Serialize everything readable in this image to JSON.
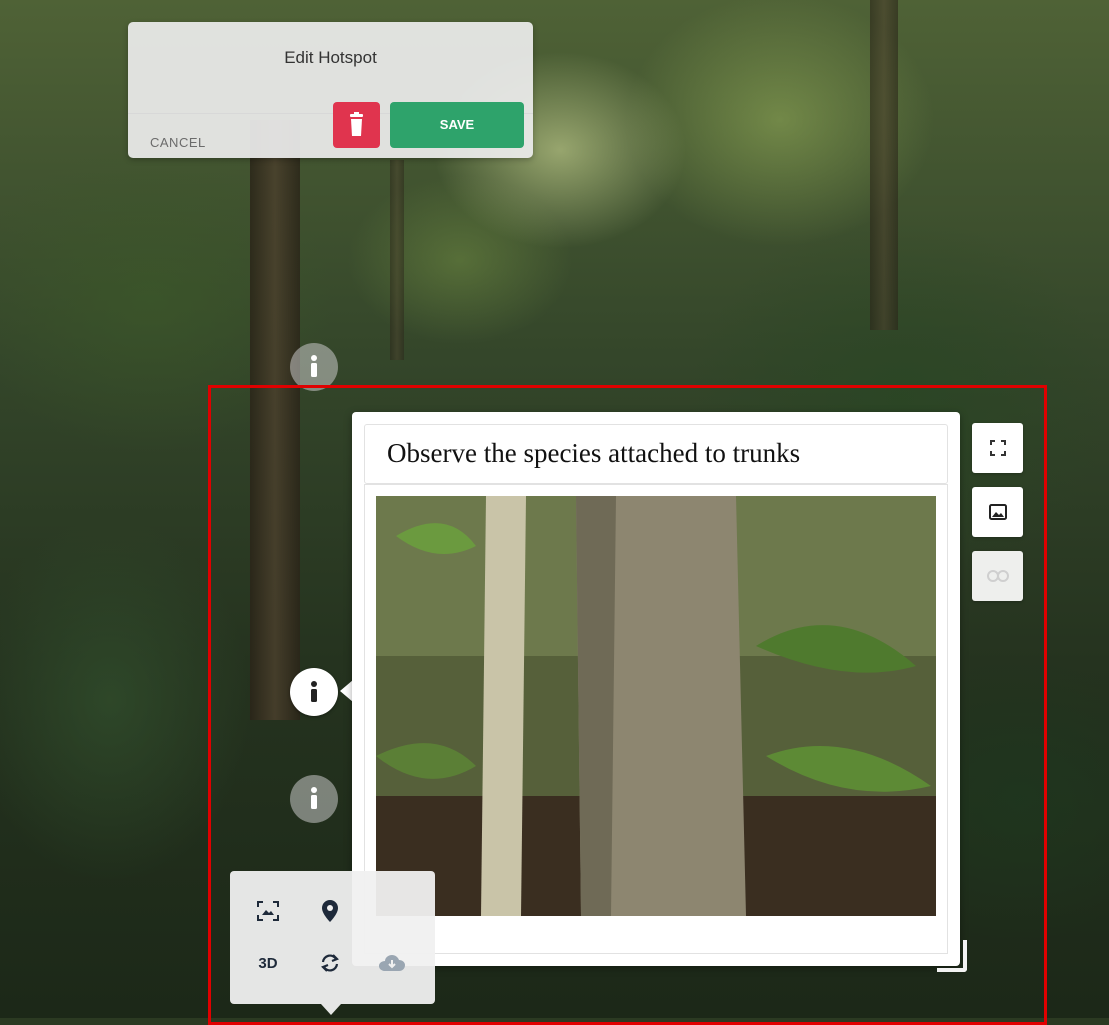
{
  "edit_panel": {
    "title": "Edit Hotspot",
    "cancel_label": "CANCEL",
    "save_label": "SAVE",
    "delete_color": "#e0344e",
    "save_color": "#2ea36b"
  },
  "info_card": {
    "title": "Observe the species attached to trunks",
    "image": "forest-trunk-photo"
  },
  "side_actions": [
    {
      "name": "fullscreen-icon",
      "enabled": true
    },
    {
      "name": "image-icon",
      "enabled": true
    },
    {
      "name": "link-icon",
      "enabled": false
    }
  ],
  "toolbar": {
    "items": [
      {
        "name": "viewfinder-icon"
      },
      {
        "name": "map-pin-icon"
      },
      {
        "name": "3d-toggle",
        "label": "3D"
      },
      {
        "name": "rotate-icon"
      },
      {
        "name": "download-icon"
      }
    ]
  },
  "hotspots": [
    {
      "name": "info-hotspot",
      "state": "dim"
    },
    {
      "name": "info-hotspot",
      "state": "active"
    },
    {
      "name": "info-hotspot",
      "state": "dim"
    }
  ],
  "colors": {
    "selection_frame": "#e00000"
  }
}
